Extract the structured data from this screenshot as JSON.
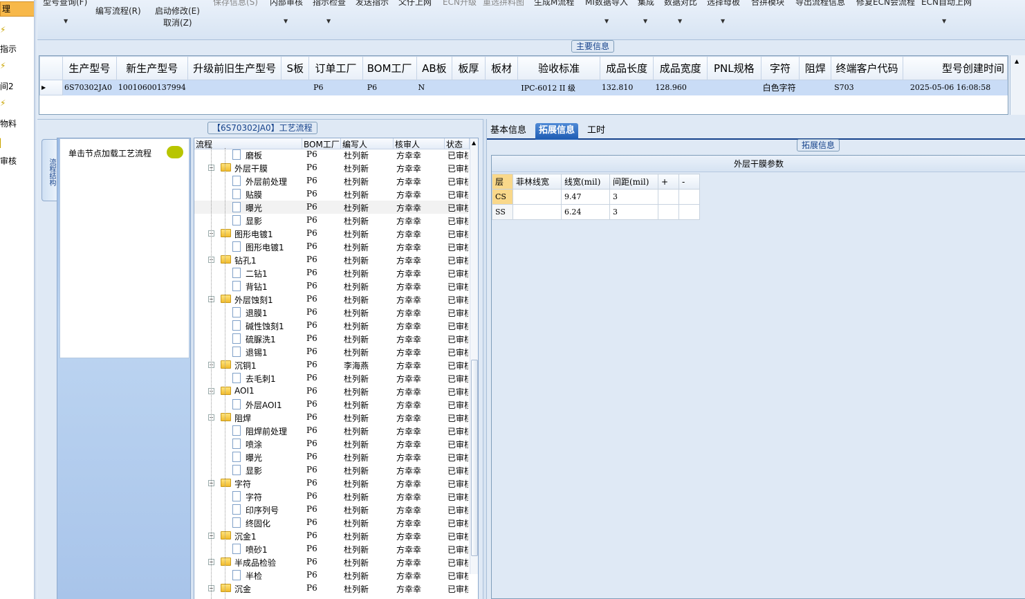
{
  "left_nav": {
    "items": [
      {
        "label": "理",
        "active": true
      },
      {
        "label": "指示"
      },
      {
        "label": "间2"
      },
      {
        "label": "物料"
      },
      {
        "label": "审核"
      }
    ]
  },
  "toolbar": {
    "buttons": [
      {
        "label": "型号查询(F)"
      },
      {
        "label": "编写流程(R)"
      },
      {
        "label": "启动修改(E)"
      },
      {
        "label": "取消(Z)"
      },
      {
        "label": "保存信息(S)"
      },
      {
        "label": "内部审核"
      },
      {
        "label": "指示检查"
      },
      {
        "label": "发送指示"
      },
      {
        "label": "父仔上网"
      },
      {
        "label": "ECN升级"
      },
      {
        "label": "重选拼料图"
      },
      {
        "label": "生成M流程"
      },
      {
        "label": "MI数据导入"
      },
      {
        "label": "集成"
      },
      {
        "label": "数据对比"
      },
      {
        "label": "选择母板"
      },
      {
        "label": "合拼模块"
      },
      {
        "label": "导出流程信息"
      },
      {
        "label": "修复ECN会流程"
      },
      {
        "label": "ECN自动上网"
      }
    ]
  },
  "main_info": {
    "legend": "主要信息",
    "columns": [
      "生产型号",
      "新生产型号",
      "升级前旧生产型号",
      "S板",
      "订单工厂",
      "BOM工厂",
      "AB板",
      "板厚",
      "板材",
      "验收标准",
      "成品长度",
      "成品宽度",
      "PNL规格",
      "字符",
      "阻焊",
      "终端客户代码",
      "型号创建时间"
    ],
    "rows": [
      [
        "6S70302JA0",
        "10010600137994",
        "",
        "",
        "P6",
        "P6",
        "N",
        "",
        "",
        "IPC-6012 II 级",
        "132.810",
        "128.960",
        "",
        "白色字符",
        "",
        "S703",
        "2025-05-06 16:08:58"
      ]
    ]
  },
  "flow": {
    "title": "【6S70302JA0】工艺流程",
    "side_tab": "流程结构",
    "load_hint": "单击节点加载工艺流程",
    "columns": [
      "流程",
      "BOM工厂",
      "编写人",
      "核审人",
      "状态"
    ],
    "rows": [
      {
        "name": "磨板",
        "level": 2,
        "bom": "P6",
        "writer": "杜列新",
        "reviewer": "方幸幸",
        "status": "已审核"
      },
      {
        "name": "外层干膜",
        "level": 1,
        "bom": "P6",
        "writer": "杜列新",
        "reviewer": "方幸幸",
        "status": "已审核"
      },
      {
        "name": "外层前处理",
        "level": 2,
        "bom": "P6",
        "writer": "杜列新",
        "reviewer": "方幸幸",
        "status": "已审核"
      },
      {
        "name": "贴膜",
        "level": 2,
        "bom": "P6",
        "writer": "杜列新",
        "reviewer": "方幸幸",
        "status": "已审核"
      },
      {
        "name": "曝光",
        "level": 2,
        "bom": "P6",
        "writer": "杜列新",
        "reviewer": "方幸幸",
        "status": "已审核",
        "selected": true
      },
      {
        "name": "显影",
        "level": 2,
        "bom": "P6",
        "writer": "杜列新",
        "reviewer": "方幸幸",
        "status": "已审核"
      },
      {
        "name": "图形电镀1",
        "level": 1,
        "bom": "P6",
        "writer": "杜列新",
        "reviewer": "方幸幸",
        "status": "已审核"
      },
      {
        "name": "图形电镀1",
        "level": 2,
        "bom": "P6",
        "writer": "杜列新",
        "reviewer": "方幸幸",
        "status": "已审核"
      },
      {
        "name": "钻孔1",
        "level": 1,
        "bom": "P6",
        "writer": "杜列新",
        "reviewer": "方幸幸",
        "status": "已审核"
      },
      {
        "name": "二钻1",
        "level": 2,
        "bom": "P6",
        "writer": "杜列新",
        "reviewer": "方幸幸",
        "status": "已审核"
      },
      {
        "name": "背钻1",
        "level": 2,
        "bom": "P6",
        "writer": "杜列新",
        "reviewer": "方幸幸",
        "status": "已审核"
      },
      {
        "name": "外层蚀刻1",
        "level": 1,
        "bom": "P6",
        "writer": "杜列新",
        "reviewer": "方幸幸",
        "status": "已审核"
      },
      {
        "name": "退膜1",
        "level": 2,
        "bom": "P6",
        "writer": "杜列新",
        "reviewer": "方幸幸",
        "status": "已审核"
      },
      {
        "name": "碱性蚀刻1",
        "level": 2,
        "bom": "P6",
        "writer": "杜列新",
        "reviewer": "方幸幸",
        "status": "已审核"
      },
      {
        "name": "硫脲洗1",
        "level": 2,
        "bom": "P6",
        "writer": "杜列新",
        "reviewer": "方幸幸",
        "status": "已审核"
      },
      {
        "name": "退锡1",
        "level": 2,
        "bom": "P6",
        "writer": "杜列新",
        "reviewer": "方幸幸",
        "status": "已审核"
      },
      {
        "name": "沉铜1",
        "level": 1,
        "bom": "P6",
        "writer": "李海燕",
        "reviewer": "方幸幸",
        "status": "已审核"
      },
      {
        "name": "去毛刺1",
        "level": 2,
        "bom": "P6",
        "writer": "杜列新",
        "reviewer": "方幸幸",
        "status": "已审核"
      },
      {
        "name": "AOI1",
        "level": 1,
        "bom": "P6",
        "writer": "杜列新",
        "reviewer": "方幸幸",
        "status": "已审核"
      },
      {
        "name": "外层AOI1",
        "level": 2,
        "bom": "P6",
        "writer": "杜列新",
        "reviewer": "方幸幸",
        "status": "已审核"
      },
      {
        "name": "阻焊",
        "level": 1,
        "bom": "P6",
        "writer": "杜列新",
        "reviewer": "方幸幸",
        "status": "已审核"
      },
      {
        "name": "阻焊前处理",
        "level": 2,
        "bom": "P6",
        "writer": "杜列新",
        "reviewer": "方幸幸",
        "status": "已审核"
      },
      {
        "name": "喷涂",
        "level": 2,
        "bom": "P6",
        "writer": "杜列新",
        "reviewer": "方幸幸",
        "status": "已审核"
      },
      {
        "name": "曝光",
        "level": 2,
        "bom": "P6",
        "writer": "杜列新",
        "reviewer": "方幸幸",
        "status": "已审核"
      },
      {
        "name": "显影",
        "level": 2,
        "bom": "P6",
        "writer": "杜列新",
        "reviewer": "方幸幸",
        "status": "已审核"
      },
      {
        "name": "字符",
        "level": 1,
        "bom": "P6",
        "writer": "杜列新",
        "reviewer": "方幸幸",
        "status": "已审核"
      },
      {
        "name": "字符",
        "level": 2,
        "bom": "P6",
        "writer": "杜列新",
        "reviewer": "方幸幸",
        "status": "已审核"
      },
      {
        "name": "印序列号",
        "level": 2,
        "bom": "P6",
        "writer": "杜列新",
        "reviewer": "方幸幸",
        "status": "已审核"
      },
      {
        "name": "终固化",
        "level": 2,
        "bom": "P6",
        "writer": "杜列新",
        "reviewer": "方幸幸",
        "status": "已审核"
      },
      {
        "name": "沉金1",
        "level": 1,
        "bom": "P6",
        "writer": "杜列新",
        "reviewer": "方幸幸",
        "status": "已审核"
      },
      {
        "name": "喷砂1",
        "level": 2,
        "bom": "P6",
        "writer": "杜列新",
        "reviewer": "方幸幸",
        "status": "已审核"
      },
      {
        "name": "半成品检验",
        "level": 1,
        "bom": "P6",
        "writer": "杜列新",
        "reviewer": "方幸幸",
        "status": "已审核"
      },
      {
        "name": "半检",
        "level": 2,
        "bom": "P6",
        "writer": "杜列新",
        "reviewer": "方幸幸",
        "status": "已审核"
      },
      {
        "name": "沉金",
        "level": 1,
        "bom": "P6",
        "writer": "杜列新",
        "reviewer": "方幸幸",
        "status": "已审核"
      }
    ]
  },
  "detail": {
    "tabs": [
      {
        "label": "基本信息"
      },
      {
        "label": "拓展信息",
        "active": true
      },
      {
        "label": "工时"
      }
    ],
    "legend": "拓展信息",
    "film_title": "外层干膜参数",
    "film_columns": [
      "层",
      "菲林线宽",
      "线宽(mil)",
      "间距(mil)",
      "+",
      "-"
    ],
    "film_rows": [
      {
        "layer": "CS",
        "film_width": "",
        "line_width": "9.47",
        "spacing": "3",
        "selected": true
      },
      {
        "layer": "SS",
        "film_width": "",
        "line_width": "6.24",
        "spacing": "3"
      }
    ]
  }
}
